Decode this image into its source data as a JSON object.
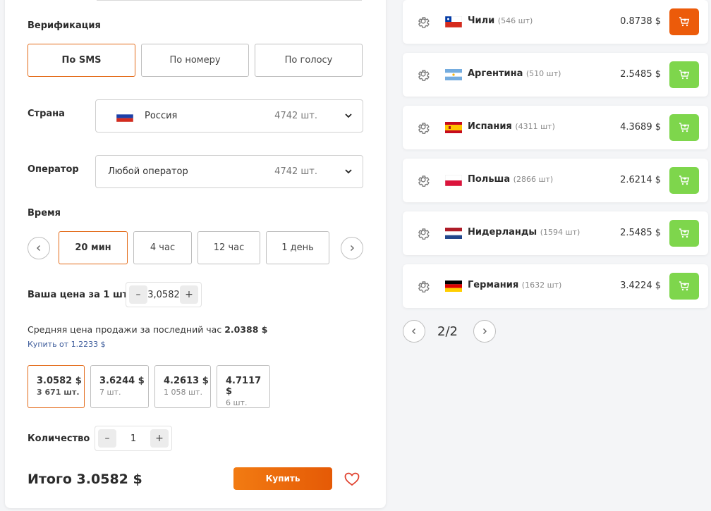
{
  "verification": {
    "label": "Верификация",
    "options": [
      "По SMS",
      "По номеру",
      "По голосу"
    ],
    "selected": "По SMS"
  },
  "country": {
    "label": "Страна",
    "value": "Россия",
    "count": "4742 шт."
  },
  "operator": {
    "label": "Оператор",
    "value": "Любой оператор",
    "count": "4742 шт."
  },
  "time": {
    "label": "Время",
    "options": [
      "20 мин",
      "4 час",
      "12 час",
      "1 день"
    ],
    "selected": "20 мин"
  },
  "your_price": {
    "label": "Ваша цена за 1 шт",
    "value": "3,0582"
  },
  "avg_price": {
    "text": "Средняя цена продажи за последний час",
    "value": "2.0388 $",
    "buy_from": "Купить от 1.2233 $"
  },
  "price_options": [
    {
      "price": "3.0582 $",
      "count": "3 671 шт."
    },
    {
      "price": "3.6244 $",
      "count": "7 шт."
    },
    {
      "price": "4.2613 $",
      "count": "1 058 шт."
    },
    {
      "price": "4.7117 $",
      "count": "6 шт."
    }
  ],
  "quantity": {
    "label": "Количество",
    "value": "1"
  },
  "total": {
    "text": "Итого 3.0582 $"
  },
  "buy_button": "Купить",
  "countries": [
    {
      "name": "Чили",
      "count": "(546 шт)",
      "price": "0.8738 $",
      "flag": "chile-flag",
      "cart_color": "#ec5b0a"
    },
    {
      "name": "Аргентина",
      "count": "(510 шт)",
      "price": "2.5485 $",
      "flag": "argentina-flag",
      "cart_color": "#7ed64c"
    },
    {
      "name": "Испания",
      "count": "(4311 шт)",
      "price": "4.3689 $",
      "flag": "spain-flag",
      "cart_color": "#7ed64c"
    },
    {
      "name": "Польша",
      "count": "(2866 шт)",
      "price": "2.6214 $",
      "flag": "poland-flag",
      "cart_color": "#7ed64c"
    },
    {
      "name": "Нидерланды",
      "count": "(1594 шт)",
      "price": "2.5485 $",
      "flag": "netherlands-flag",
      "cart_color": "#7ed64c"
    },
    {
      "name": "Германия",
      "count": "(1632 шт)",
      "price": "3.4224 $",
      "flag": "germany-flag",
      "cart_color": "#7ed64c"
    }
  ],
  "pagination": {
    "text": "2/2"
  },
  "colors": {
    "accent": "#e36a18",
    "cart_green": "#7ed64c",
    "cart_orange": "#ec5b0a",
    "heart": "#e0412e"
  }
}
